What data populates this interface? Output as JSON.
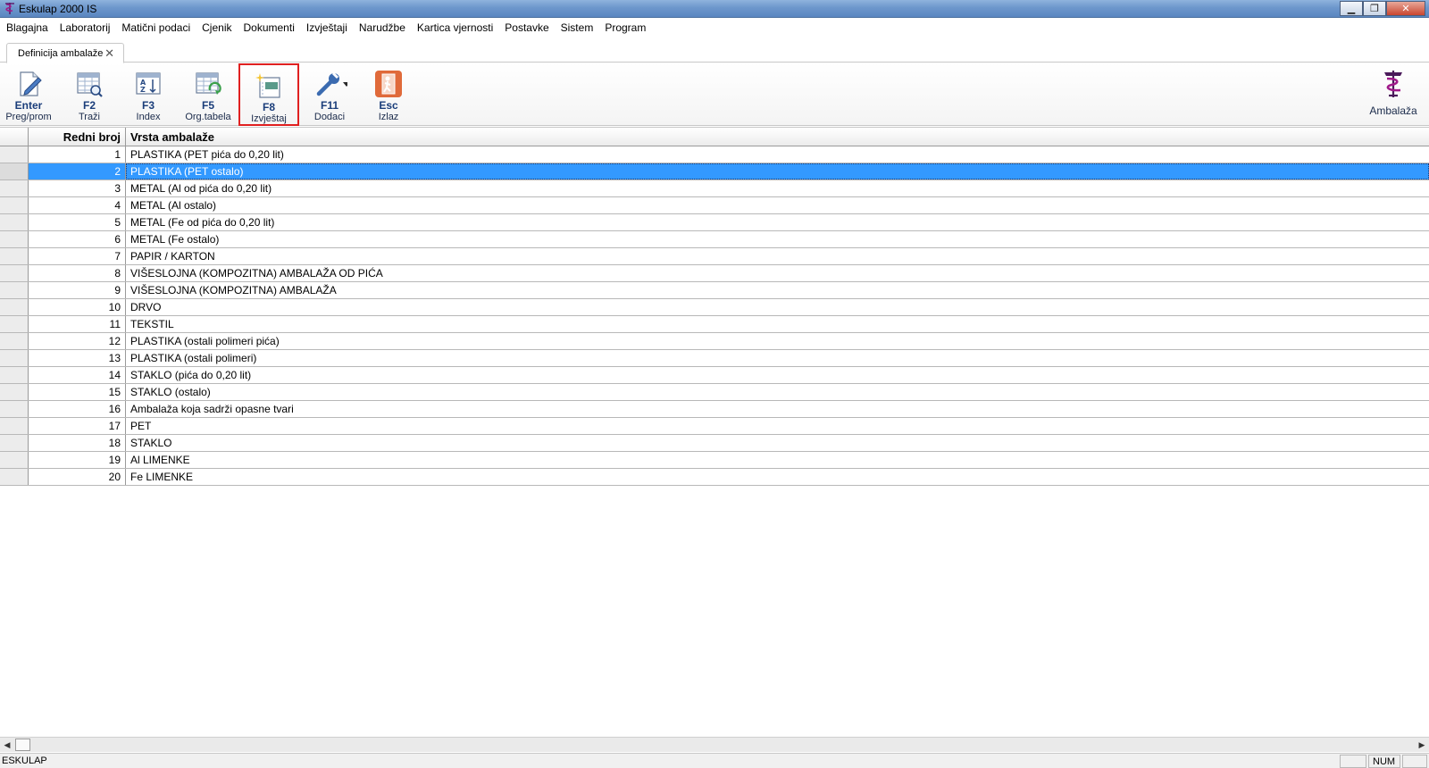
{
  "window": {
    "title": "Eskulap 2000  IS",
    "minimize": "▁",
    "restore": "❐",
    "close": "✕"
  },
  "menu": [
    "Blagajna",
    "Laboratorij",
    "Matični podaci",
    "Cjenik",
    "Dokumenti",
    "Izvještaji",
    "Narudžbe",
    "Kartica vjernosti",
    "Postavke",
    "Sistem",
    "Program"
  ],
  "tab": {
    "label": "Definicija ambalaže",
    "close": "✕"
  },
  "toolbar": {
    "enter": {
      "key": "Enter",
      "label": "Preg/prom",
      "icon": "edit-document-icon"
    },
    "f2": {
      "key": "F2",
      "label": "Traži",
      "icon": "table-search-icon"
    },
    "f3": {
      "key": "F3",
      "label": "Index",
      "icon": "sort-az-icon"
    },
    "f5": {
      "key": "F5",
      "label": "Org.tabela",
      "icon": "table-refresh-icon"
    },
    "f8": {
      "key": "F8",
      "label": "Izvještaj",
      "icon": "report-icon"
    },
    "f11": {
      "key": "F11",
      "label": "Dodaci",
      "icon": "wrench-dropdown-icon"
    },
    "esc": {
      "key": "Esc",
      "label": "Izlaz",
      "icon": "exit-icon"
    },
    "right": {
      "label": "Ambalaža",
      "icon": "pharmacy-logo-icon"
    }
  },
  "grid": {
    "columns": [
      "Redni broj",
      "Vrsta ambalaže"
    ],
    "selected_row": 2,
    "rows": [
      {
        "num": "1",
        "text": "PLASTIKA (PET pića do 0,20 lit)"
      },
      {
        "num": "2",
        "text": "PLASTIKA (PET ostalo)"
      },
      {
        "num": "3",
        "text": "METAL (Al od pića do 0,20 lit)"
      },
      {
        "num": "4",
        "text": "METAL (Al ostalo)"
      },
      {
        "num": "5",
        "text": "METAL (Fe od pića do 0,20 lit)"
      },
      {
        "num": "6",
        "text": "METAL (Fe ostalo)"
      },
      {
        "num": "7",
        "text": "PAPIR / KARTON"
      },
      {
        "num": "8",
        "text": "VIŠESLOJNA (KOMPOZITNA) AMBALAŽA OD PIĆA"
      },
      {
        "num": "9",
        "text": "VIŠESLOJNA (KOMPOZITNA) AMBALAŽA"
      },
      {
        "num": "10",
        "text": "DRVO"
      },
      {
        "num": "11",
        "text": "TEKSTIL"
      },
      {
        "num": "12",
        "text": "PLASTIKA (ostali polimeri pića)"
      },
      {
        "num": "13",
        "text": "PLASTIKA (ostali polimeri)"
      },
      {
        "num": "14",
        "text": "STAKLO (pića do 0,20 lit)"
      },
      {
        "num": "15",
        "text": "STAKLO (ostalo)"
      },
      {
        "num": "16",
        "text": "Ambalaža koja sadrži opasne tvari"
      },
      {
        "num": "17",
        "text": "PET"
      },
      {
        "num": "18",
        "text": "STAKLO"
      },
      {
        "num": "19",
        "text": "Al LIMENKE"
      },
      {
        "num": "20",
        "text": "Fe LIMENKE"
      }
    ]
  },
  "scrollbar": {
    "left": "◀",
    "right": "▶"
  },
  "status": {
    "left": "ESKULAP",
    "num": "NUM"
  },
  "colors": {
    "selection": "#3399ff",
    "highlight_border": "#e02020",
    "titlebar": "#6d97cc"
  }
}
